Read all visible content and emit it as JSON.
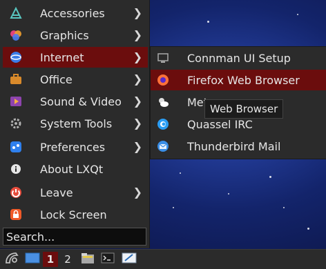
{
  "menu": {
    "items": [
      {
        "label": "Accessories",
        "icon": "accessories-icon",
        "arrow": "❯"
      },
      {
        "label": "Graphics",
        "icon": "graphics-icon",
        "arrow": "❯"
      },
      {
        "label": "Internet",
        "icon": "internet-icon",
        "arrow": "❯"
      },
      {
        "label": "Office",
        "icon": "office-icon",
        "arrow": "❯"
      },
      {
        "label": "Sound & Video",
        "icon": "sound-video-icon",
        "arrow": "❯"
      },
      {
        "label": "System Tools",
        "icon": "system-tools-icon",
        "arrow": "❯"
      },
      {
        "label": "Preferences",
        "icon": "preferences-icon",
        "arrow": "❯"
      },
      {
        "label": "About LXQt",
        "icon": "about-icon",
        "arrow": ""
      },
      {
        "label": "Leave",
        "icon": "leave-icon",
        "arrow": "❯"
      },
      {
        "label": "Lock Screen",
        "icon": "lock-icon",
        "arrow": ""
      }
    ],
    "search_value": "Search..."
  },
  "submenu": {
    "items": [
      {
        "label": "Connman UI Setup",
        "icon": "connman-icon"
      },
      {
        "label": "Firefox Web Browser",
        "icon": "firefox-icon"
      },
      {
        "label": "Meteo",
        "icon": "weather-icon"
      },
      {
        "label": "Quassel IRC",
        "icon": "quassel-icon"
      },
      {
        "label": "Thunderbird Mail",
        "icon": "thunderbird-icon"
      }
    ]
  },
  "tooltip": "Web Browser",
  "taskbar": {
    "desktop1": "1",
    "desktop2": "2"
  },
  "colors": {
    "highlight": "#6b0d0d",
    "menu_bg": "#2b2b2b"
  }
}
